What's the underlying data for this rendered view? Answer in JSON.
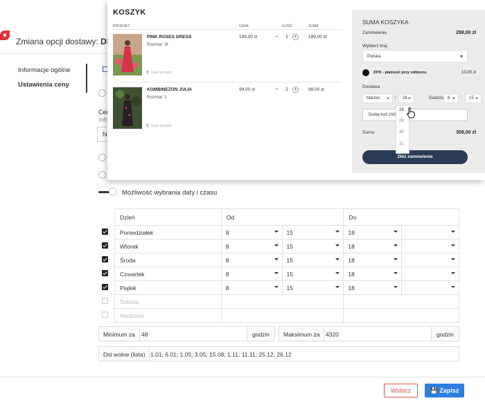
{
  "admin": {
    "title_prefix": "Zmiana opcji dostawy:",
    "title_bold": "DPD - pła",
    "sidebar": [
      {
        "label": "Informacje ogólne"
      },
      {
        "label": "Ustawienia ceny"
      }
    ],
    "ghost_heading": "Cen",
    "ghost_sub": "Info",
    "ghost_input": "Ne",
    "toggle_label": "Możliwość wybrania daty i czasu",
    "toggle_on": true,
    "schedule": {
      "headers": [
        "Dzień",
        "Od",
        "Do"
      ],
      "rows": [
        {
          "day": "Poniedziałek",
          "checked": true,
          "from_h": "8",
          "from_m": "15",
          "to_h": "18",
          "to_m": ""
        },
        {
          "day": "Wtorek",
          "checked": true,
          "from_h": "8",
          "from_m": "15",
          "to_h": "18",
          "to_m": ""
        },
        {
          "day": "Środa",
          "checked": true,
          "from_h": "8",
          "from_m": "15",
          "to_h": "18",
          "to_m": ""
        },
        {
          "day": "Czwartek",
          "checked": true,
          "from_h": "8",
          "from_m": "15",
          "to_h": "18",
          "to_m": ""
        },
        {
          "day": "Piątek",
          "checked": true,
          "from_h": "8",
          "from_m": "15",
          "to_h": "18",
          "to_m": ""
        },
        {
          "day": "Sobota",
          "checked": false
        },
        {
          "day": "Niedziela",
          "checked": false
        }
      ]
    },
    "minimum": {
      "label": "Minimum za",
      "value": "48",
      "unit": "godzin"
    },
    "maximum": {
      "label": "Maksimum za",
      "value": "4320",
      "unit": "godzin"
    },
    "days_off": {
      "label": "Dni wolne (lista)",
      "value": "1.01; 6.01; 1.05; 3.05; 15.08; 1.11; 11.11; 25.12; 26.12"
    },
    "back_label": "Wstecz",
    "save_label": "Zapisz",
    "colors": {
      "accent": "#2d7ee0",
      "danger": "#d9534f"
    }
  },
  "cart": {
    "title": "KOSZYK",
    "columns": [
      "PRODUKT",
      "CENA",
      "ILOŚĆ",
      "SUMA"
    ],
    "items": [
      {
        "name": "PINK ROSES DRESS",
        "size": "Rozmiar: M",
        "remove": "Usuń produkt",
        "price": "199,00 zł",
        "qty": "1",
        "total": "199,00 zł"
      },
      {
        "name": "KOMBINEZON JULIA",
        "size": "Rozmiar: L",
        "remove": "Usuń produkt",
        "price": "99,00 zł",
        "qty": "1",
        "total": "99,00 zł"
      }
    ],
    "summary": {
      "title": "SUMA KOSZYKA",
      "order_label": "Zamówienie",
      "order_value": "298,00 zł",
      "country_label": "Wybierz kraj",
      "country_value": "Polska",
      "shipping_label": "DPD - płatność przy odbiorze",
      "shipping_price": "10,00 zł",
      "date_label": "Dostawa",
      "month_value": "Marzec",
      "date_sep": "/",
      "day_value": "28",
      "hour_label": "Godzina",
      "hour_value": "8",
      "minute_value": "15",
      "discount_placeholder": "Dodaj kod zniżk",
      "day_options": [
        "28",
        "29",
        "30",
        "31"
      ],
      "total_label": "Suma",
      "total_value": "308,00 zł",
      "order_button": "Złóż zamówienie"
    }
  }
}
